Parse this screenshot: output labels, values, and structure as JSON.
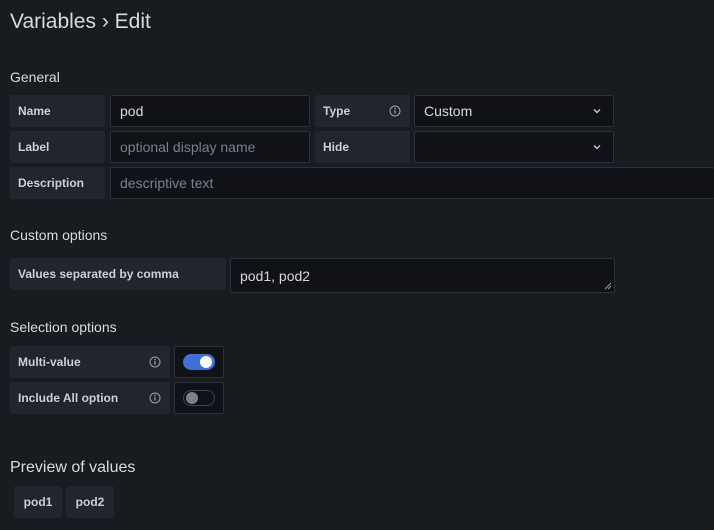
{
  "title": "Variables › Edit",
  "general": {
    "heading": "General",
    "name": {
      "label": "Name",
      "value": "pod"
    },
    "type": {
      "label": "Type",
      "value": "Custom"
    },
    "label_field": {
      "label": "Label",
      "placeholder": "optional display name"
    },
    "hide": {
      "label": "Hide",
      "value": ""
    },
    "description": {
      "label": "Description",
      "placeholder": "descriptive text"
    }
  },
  "custom_options": {
    "heading": "Custom options",
    "values_label": "Values separated by comma",
    "values": "pod1, pod2"
  },
  "selection_options": {
    "heading": "Selection options",
    "multi_value": {
      "label": "Multi-value",
      "enabled": true
    },
    "include_all": {
      "label": "Include All option",
      "enabled": false
    }
  },
  "preview": {
    "heading": "Preview of values",
    "values": [
      "pod1",
      "pod2"
    ]
  },
  "colors": {
    "background": "#181b1f",
    "label_background": "#22252b",
    "input_background": "#111217",
    "accent": "#3d71d9"
  },
  "icons": [
    "info-icon",
    "chevron-down-icon",
    "resize-grip-icon"
  ]
}
